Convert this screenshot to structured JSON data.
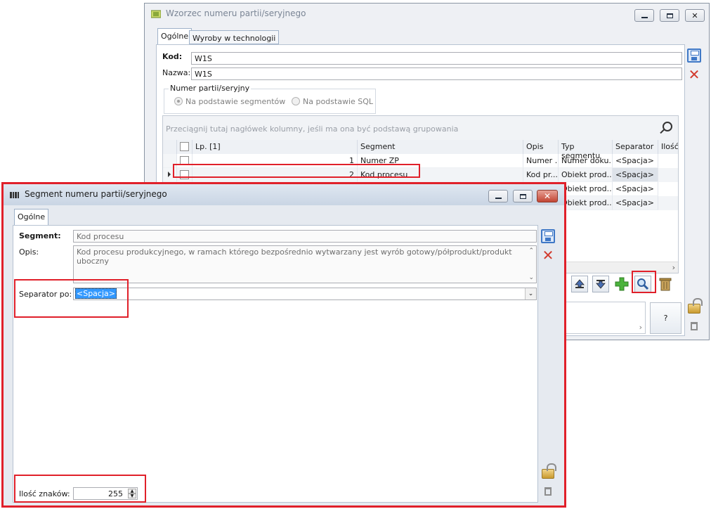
{
  "back_window": {
    "title": "Wzorzec numeru partii/seryjnego",
    "tabs": [
      "Ogólne",
      "Wyroby w technologii"
    ],
    "kod_label": "Kod:",
    "kod_value": "W1S",
    "nazwa_label": "Nazwa:",
    "nazwa_value": "W1S",
    "group_title": "Numer partii/seryjny",
    "radio_segments": "Na podstawie segmentów",
    "radio_sql": "Na podstawie SQL",
    "grid_hint": "Przeciągnij tutaj nagłówek kolumny, jeśli ma ona być podstawą grupowania",
    "columns": [
      "Lp. [1]",
      "Segment",
      "Opis",
      "Typ segmentu",
      "Separator",
      "Ilość"
    ],
    "rows": [
      {
        "lp": "1",
        "segment": "Numer ZP",
        "opis": "Numer ...",
        "typ": "Numer doku...",
        "sep": "<Spacja>"
      },
      {
        "lp": "2",
        "segment": "Kod procesu",
        "opis": "Kod pr...",
        "typ": "Obiekt prod...",
        "sep": "<Spacja>"
      },
      {
        "lp": "",
        "segment": "",
        "opis": "",
        "typ": "Obiekt prod...",
        "sep": "<Spacja>"
      },
      {
        "lp": "",
        "segment": "",
        "opis": "",
        "typ": "Obiekt prod...",
        "sep": "<Spacja>"
      }
    ],
    "help_button": "?"
  },
  "front_window": {
    "title": "Segment numeru partii/seryjnego",
    "tab": "Ogólne",
    "segment_label": "Segment:",
    "segment_value": "Kod procesu",
    "opis_label": "Opis:",
    "opis_value": "Kod procesu produkcyjnego, w ramach którego bezpośrednio wytwarzany jest wyrób gotowy/półprodukt/produkt uboczny",
    "separator_label": "Separator po:",
    "separator_value": "<Spacja>",
    "ilosc_label": "Ilość znaków:",
    "ilosc_value": "255"
  },
  "colors": {
    "highlight": "#e0202a",
    "selection": "#3399ff",
    "accent": "#3f78c6"
  }
}
